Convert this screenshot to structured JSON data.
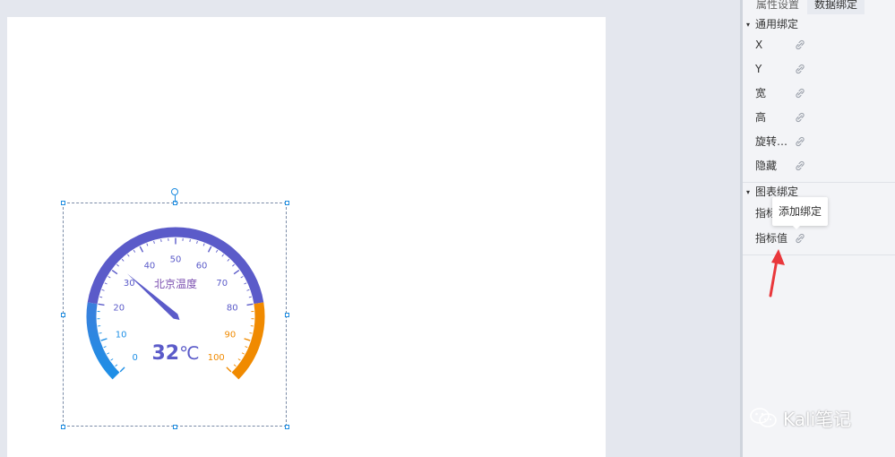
{
  "panel": {
    "tabs": [
      "属性设置",
      "数据绑定"
    ],
    "general_group": {
      "title": "通用绑定",
      "items": [
        "X",
        "Y",
        "宽",
        "高",
        "旋转…",
        "隐藏"
      ]
    },
    "chart_group": {
      "title": "图表绑定",
      "items": [
        "指标",
        "指标值"
      ]
    },
    "tooltip": "添加绑定",
    "icons": {
      "bind": "link-icon",
      "expand": "caret-down-icon"
    }
  },
  "gauge": {
    "title": "北京温度",
    "value": 32,
    "value_text": "32",
    "unit": "℃",
    "min": 0,
    "max": 100,
    "ticks": [
      "0",
      "10",
      "20",
      "30",
      "40",
      "50",
      "60",
      "70",
      "80",
      "90",
      "100"
    ],
    "colors": {
      "low": "#1e8fe6",
      "mid": "#5b5bc9",
      "high": "#f08a00"
    }
  },
  "watermark": "Kali笔记",
  "colors": {
    "selection": "#1d8ce0",
    "arrow": "#e9373b"
  }
}
